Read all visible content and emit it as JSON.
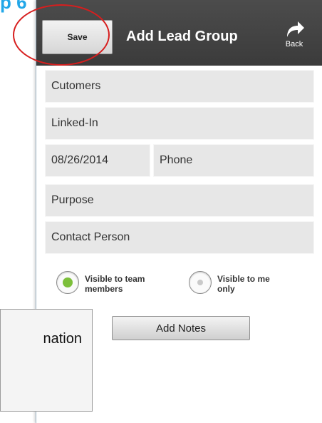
{
  "colors": {
    "slide_accent": "#22a7e8",
    "appbar": "#434343",
    "field_bg": "#e7e7e7",
    "radio_selected": "#7cbf3a",
    "radio_unselected": "#c9c9c9",
    "highlight_ring": "#d71e1e"
  },
  "slide": {
    "title_fragment": "p 6"
  },
  "appbar": {
    "save_label": "Save",
    "title": "Add Lead Group",
    "back_label": "Back",
    "back_icon": "back-arrow-icon"
  },
  "form": {
    "group_name": {
      "value": "Cutomers"
    },
    "source": {
      "value": "Linked-In"
    },
    "date": {
      "value": "08/26/2014"
    },
    "method": {
      "value": "Phone"
    },
    "purpose": {
      "placeholder": "Purpose"
    },
    "contact_person": {
      "placeholder": "Contact Person"
    }
  },
  "visibility": {
    "options": [
      {
        "label_line1": "Visible to team",
        "label_line2": "members",
        "selected": true
      },
      {
        "label_line1": "Visible to me",
        "label_line2": "only",
        "selected": false
      }
    ]
  },
  "notes_button": {
    "label": "Add Notes"
  },
  "callout": {
    "text": "nation"
  }
}
